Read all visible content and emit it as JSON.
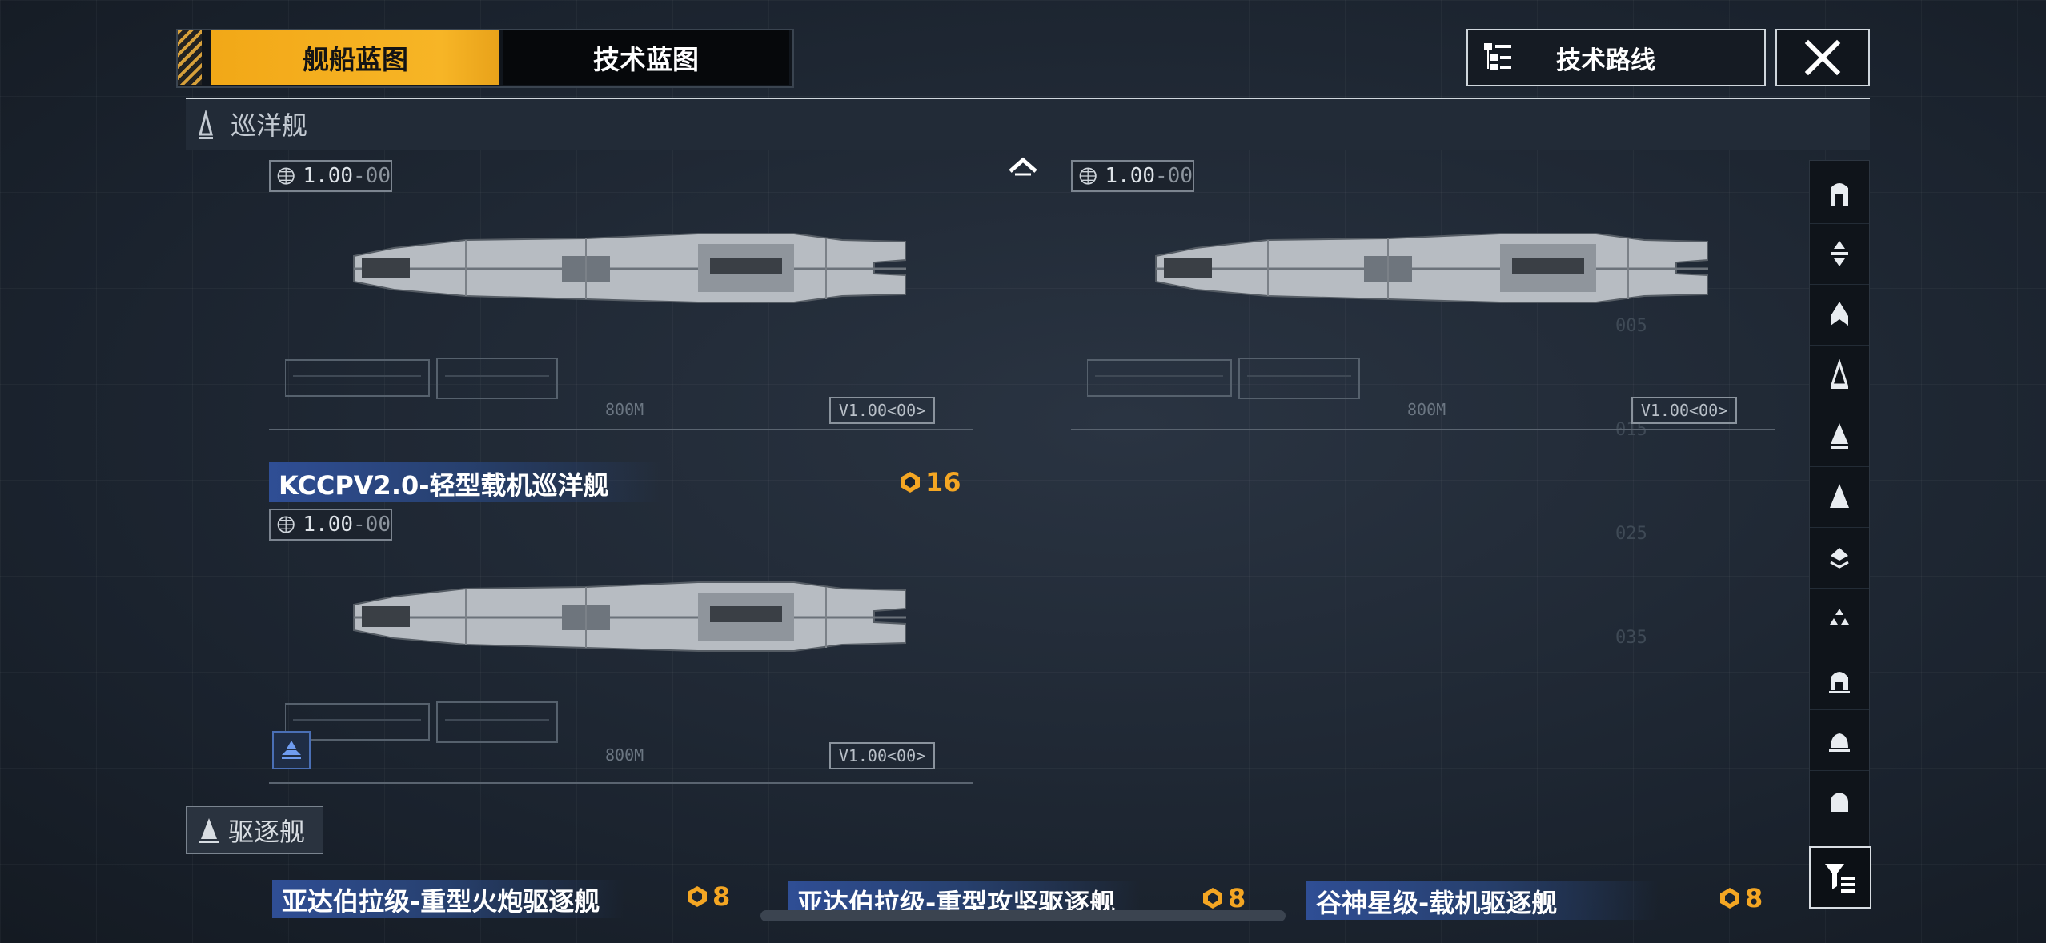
{
  "tabs": [
    {
      "label": "舰船蓝图",
      "active": true
    },
    {
      "label": "技术蓝图",
      "active": false
    }
  ],
  "header": {
    "tech_route_label": "技术路线",
    "close_icon": "close-icon"
  },
  "section_cruiser": {
    "title": "巡洋舰",
    "icon": "cruiser-class-icon"
  },
  "cards": [
    {
      "title": "",
      "cost": "",
      "version": "1.00",
      "version_suffix": "-00",
      "tag": "V1.00<00>",
      "distance": "800M"
    },
    {
      "title": "",
      "cost": "",
      "version": "1.00",
      "version_suffix": "-00",
      "tag": "V1.00<00>",
      "distance": "800M"
    },
    {
      "title": "KCCPV2.0-轻型载机巡洋舰",
      "cost": "16",
      "version": "1.00",
      "version_suffix": "-00",
      "tag": "V1.00<00>",
      "distance": "800M",
      "badge_icon": "carrier-badge-icon"
    }
  ],
  "section_destroyer": {
    "title": "驱逐舰",
    "icon": "destroyer-class-icon"
  },
  "destroyer_cards": [
    {
      "title": "亚达伯拉级-重型火炮驱逐舰",
      "cost": "8"
    },
    {
      "title": "亚达伯拉级-重型攻坚驱逐舰",
      "cost": "8"
    },
    {
      "title": "谷神星级-载机驱逐舰",
      "cost": "8"
    }
  ],
  "filter_bar": {
    "items": [
      "ship-class-icon-1",
      "ship-class-icon-2",
      "ship-class-icon-3",
      "ship-class-icon-4",
      "ship-class-icon-5",
      "ship-class-icon-6",
      "ship-class-icon-7",
      "ship-class-icon-8",
      "ship-class-icon-9",
      "ship-class-icon-10",
      "ship-class-icon-11"
    ],
    "filter_icon": "filter-icon"
  },
  "colors": {
    "accent": "#f4a623",
    "title_blue": "#2f4e95",
    "background": "#1b2430"
  }
}
